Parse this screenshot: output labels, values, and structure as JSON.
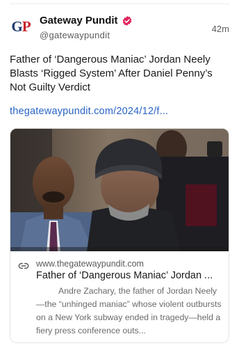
{
  "post": {
    "author": {
      "display_name": "Gateway Pundit",
      "handle": "@gatewaypundit",
      "logo_text_g": "G",
      "logo_text_p": "P",
      "verified_color": "#e0245e"
    },
    "time": "42m",
    "text": "Father of ‘Dangerous Maniac’ Jordan Neely Blasts ‘Rigged System’ After Daniel Penny’s Not Guilty Verdict",
    "link": "thegatewaypundit.com/2024/12/f..."
  },
  "card": {
    "domain": "www.thegatewaypundit.com",
    "title": "Father of ‘Dangerous Maniac’ Jordan ...",
    "description": "Andre Zachary, the father of Jordan Neely—the “unhinged maniac” whose violent outbursts on a New York subway ended in tragedy—held a fiery press conference outs...",
    "icon": "link-icon"
  },
  "colors": {
    "link": "#2a64c5",
    "logo_blue": "#1f3b6e",
    "logo_red": "#c8202b"
  }
}
